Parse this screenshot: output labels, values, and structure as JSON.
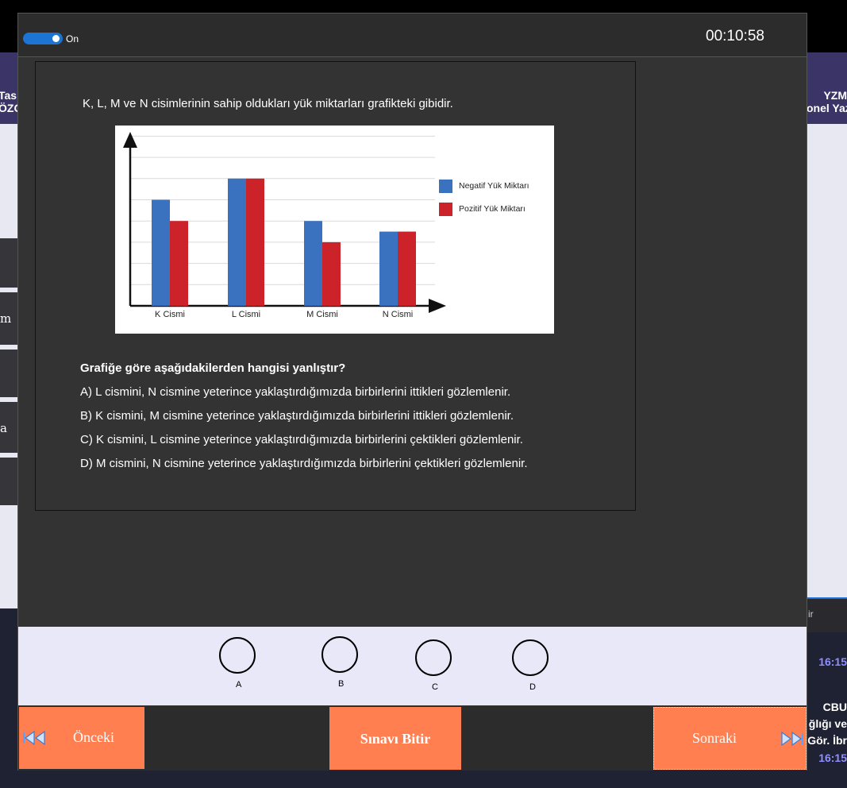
{
  "background": {
    "left_header_lines": [
      "Tas",
      "ÖZG"
    ],
    "left_block_letters": [
      "m",
      "a"
    ],
    "right_header_lines": [
      "YZM",
      "onel Yaz"
    ],
    "right_search_text": "ir",
    "right_time_1": "16:15",
    "right_card_lines": [
      "CBU",
      "ğlığı ve",
      "Gör. İbr"
    ],
    "right_time_2": "16:15"
  },
  "topbar": {
    "toggle_label": "On",
    "timer": "00:10:58"
  },
  "question": {
    "intro": "K, L, M ve N cisimlerinin sahip oldukları yük miktarları grafikteki gibidir.",
    "prompt": "Grafiğe göre aşağıdakilerden hangisi yanlıştır?",
    "options": [
      "A) L cismini, N cismine yeterince yaklaştırdığımızda birbirlerini ittikleri gözlemlenir.",
      "B) K cismini, M cismine yeterince yaklaştırdığımızda birbirlerini ittikleri gözlemlenir.",
      "C) K cismini, L cismine yeterince yaklaştırdığımızda birbirlerini çektikleri gözlemlenir.",
      "D) M cismini, N cismine yeterince yaklaştırdığımızda birbirlerini çektikleri gözlemlenir."
    ]
  },
  "chart_data": {
    "type": "bar",
    "categories": [
      "K Cismi",
      "L Cismi",
      "M Cismi",
      "N Cismi"
    ],
    "series": [
      {
        "name": "Negatif Yük Miktarı",
        "color": "#3a72c0",
        "values": [
          5,
          6,
          4,
          3.5
        ]
      },
      {
        "name": "Pozitif Yük Miktarı",
        "color": "#cc2229",
        "values": [
          4,
          6,
          3,
          3.5
        ]
      }
    ],
    "ylim": [
      0,
      8
    ],
    "grid": true,
    "legend": "right"
  },
  "answers": {
    "labels": [
      "A",
      "B",
      "C",
      "D"
    ]
  },
  "buttons": {
    "prev": "Önceki",
    "finish": "Sınavı Bitir",
    "next": "Sonraki"
  }
}
